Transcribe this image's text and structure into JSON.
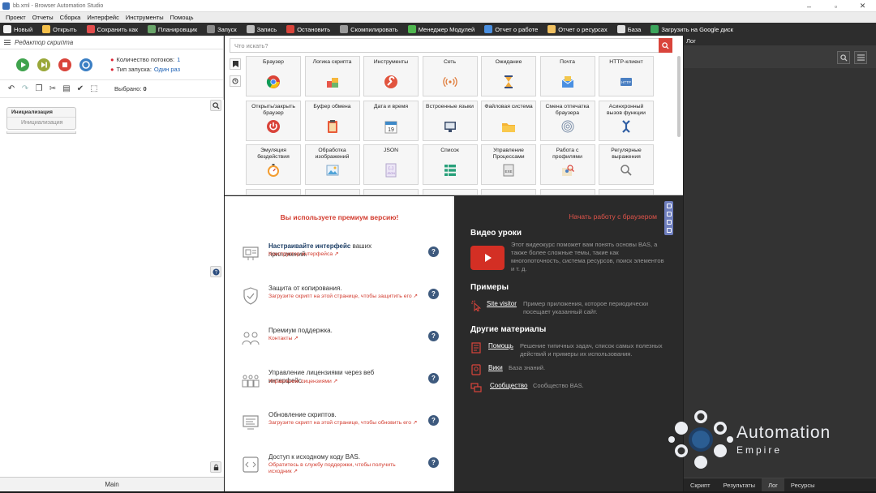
{
  "window": {
    "title": "bb.xml - Browser Automation Studio"
  },
  "menu": [
    "Проект",
    "Отчеты",
    "Сборка",
    "Интерфейс",
    "Инструменты",
    "Помощь"
  ],
  "toolbar": [
    {
      "label": "Новый",
      "color": "#f2f2f2"
    },
    {
      "label": "Открыть",
      "color": "#f5c04a"
    },
    {
      "label": "Сохранить как",
      "color": "#e24c4c"
    },
    {
      "label": "Планировщик",
      "color": "#6aa56a"
    },
    {
      "label": "Запуск",
      "color": "#8a8a8a"
    },
    {
      "label": "Запись",
      "color": "#bdbdbd"
    },
    {
      "label": "Остановить",
      "color": "#d9443b"
    },
    {
      "label": "Скомпилировать",
      "color": "#9a9a9a"
    },
    {
      "label": "Менеджер Модулей",
      "color": "#4fb64f"
    },
    {
      "label": "Отчет о работе",
      "color": "#4a8fe0"
    },
    {
      "label": "Отчет о ресурсах",
      "color": "#f0c060"
    },
    {
      "label": "База",
      "color": "#e0e0e0"
    },
    {
      "label": "Загрузить на Google диск",
      "color": "#3ca55c"
    }
  ],
  "editor": {
    "title": "Редактор скрипта",
    "threads_label": "Количество потоков:",
    "threads_value": "1",
    "launch_label": "Тип запуска:",
    "launch_value": "Один раз",
    "selected_label": "Выбрано:",
    "selected_value": "0",
    "block_title": "Инициализация",
    "block_sub": "Инициализация",
    "main_tab": "Main"
  },
  "actions": {
    "search_placeholder": "Что искать?",
    "tiles": [
      {
        "label": "Браузер",
        "icon": "chrome-icon"
      },
      {
        "label": "Логика скрипта",
        "icon": "blocks-icon"
      },
      {
        "label": "Инструменты",
        "icon": "wrench-icon"
      },
      {
        "label": "Сеть",
        "icon": "signal-icon"
      },
      {
        "label": "Ожидание",
        "icon": "hourglass-icon"
      },
      {
        "label": "Почта",
        "icon": "mail-icon"
      },
      {
        "label": "HTTP-клиент",
        "icon": "http-icon"
      },
      {
        "label": "Открыть/закрыть браузер",
        "icon": "power-icon"
      },
      {
        "label": "Буфер обмена",
        "icon": "clipboard-icon"
      },
      {
        "label": "Дата и время",
        "icon": "calendar-icon"
      },
      {
        "label": "Встроенные языки",
        "icon": "monitor-icon"
      },
      {
        "label": "Файловая система",
        "icon": "folder-icon"
      },
      {
        "label": "Смена отпечатка браузера",
        "icon": "fingerprint-icon"
      },
      {
        "label": "Асинхронный вызов функции",
        "icon": "arrows-icon"
      },
      {
        "label": "Эмуляция бездействия",
        "icon": "stopwatch-icon"
      },
      {
        "label": "Обработка изображений",
        "icon": "image-icon"
      },
      {
        "label": "JSON",
        "icon": "json-icon"
      },
      {
        "label": "Список",
        "icon": "list-icon"
      },
      {
        "label": "Управление Процессами",
        "icon": "exe-icon"
      },
      {
        "label": "Работа с профилями",
        "icon": "profile-icon"
      },
      {
        "label": "Регулярные выражения",
        "icon": "magnifier-icon"
      }
    ]
  },
  "premium": {
    "title": "Вы используете премиум версию!",
    "features": [
      {
        "title_bold": "Настраивайте интерфейс",
        "title_rest": " ваших приложений.",
        "link": "Конструктор интерфейса"
      },
      {
        "title_bold": "",
        "title_rest": "Защита от копирования.",
        "link": "Загрузите скрипт на этой странице, чтобы защитить его"
      },
      {
        "title_bold": "",
        "title_rest": "Премиум поддержка.",
        "link": "Контакты"
      },
      {
        "title_bold": "",
        "title_rest": "Управление лицензиями через веб интерфейс.",
        "link": "Управление лицензиями"
      },
      {
        "title_bold": "",
        "title_rest": "Обновление скриптов.",
        "link": "Загрузите скрипт на этой странице, чтобы обновить его"
      },
      {
        "title_bold": "",
        "title_rest": "Доступ к исходному коду BAS.",
        "link": "Обратитесь в службу поддержки, чтобы получить исходник"
      }
    ]
  },
  "learning": {
    "start_link": "Начать работу с браузером",
    "video_title": "Видео уроки",
    "video_desc": "Этот видеокурс поможет вам понять основы BAS, а также более сложные темы, такие как многопоточность, система ресурсов, поиск элементов и т. д.",
    "examples_title": "Примеры",
    "example_link": "Site visitor",
    "example_desc": "Пример приложения, которое периодически посещает указанный сайт.",
    "other_title": "Другие материалы",
    "other": [
      {
        "link": "Помощь",
        "desc": "Решение типичных задач, список самых полезных действий и примеры их использования."
      },
      {
        "link": "Вики",
        "desc": "База знаний."
      },
      {
        "link": "Сообщество",
        "desc": "Сообщество BAS."
      }
    ]
  },
  "log": {
    "title": "Лог",
    "tabs": [
      "Скрипт",
      "Результаты",
      "Лог",
      "Ресурсы"
    ],
    "active_tab": "Лог"
  },
  "watermark": {
    "line1": "Automation",
    "line2": "Empire"
  },
  "colors": {
    "accent_red": "#d23b2e",
    "dark_bg": "#2a2a2a",
    "toolbar_bg": "#2d2d2d"
  }
}
